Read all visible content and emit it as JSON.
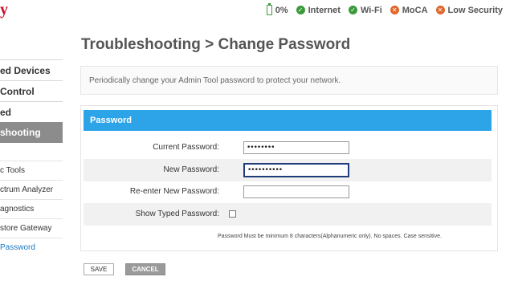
{
  "logo_fragment": "y",
  "status": {
    "battery": "0%",
    "items": [
      {
        "label": "Internet",
        "state": "ok"
      },
      {
        "label": "Wi-Fi",
        "state": "ok"
      },
      {
        "label": "MoCA",
        "state": "bad"
      },
      {
        "label": "Low Security",
        "state": "bad"
      }
    ]
  },
  "sidebar": {
    "main": [
      "ed Devices",
      " Control",
      "ed",
      "shooting"
    ],
    "sub": [
      "c Tools",
      "ctrum Analyzer",
      "agnostics",
      "store Gateway",
      "Password"
    ]
  },
  "page": {
    "title": "Troubleshooting > Change Password",
    "info": "Periodically change your Admin Tool password to protect your network."
  },
  "panel": {
    "header": "Password",
    "fields": {
      "current_label": "Current Password:",
      "current_value": "••••••••",
      "new_label": "New Password:",
      "new_value": "••••••••••",
      "reenter_label": "Re-enter New Password:",
      "reenter_value": "",
      "show_label": "Show Typed Password:"
    },
    "note": "Password Must be minimum 8 characters(Alphanumeric only). No spaces. Case sensitive."
  },
  "buttons": {
    "save": "SAVE",
    "cancel": "CANCEL"
  },
  "colors": {
    "accent": "#2ea4e8",
    "ok": "#3a9a3a",
    "bad": "#e0662a",
    "active_sidebar": "#8c8c8c"
  }
}
